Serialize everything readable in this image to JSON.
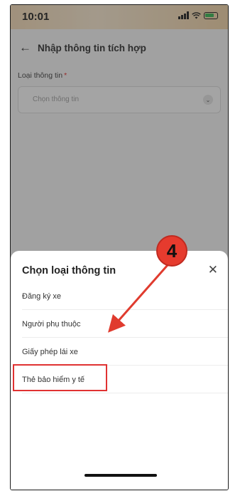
{
  "status_bar": {
    "time": "10:01"
  },
  "header": {
    "back_icon": "←",
    "title": "Nhập thông tin tích hợp"
  },
  "form": {
    "field_label": "Loại thông tin",
    "required_mark": "*",
    "select_placeholder": "Chọn thông tin",
    "chevron": "⌄"
  },
  "sheet": {
    "title": "Chọn loại thông tin",
    "close_icon": "✕",
    "options": [
      {
        "label": "Đăng ký xe"
      },
      {
        "label": "Người phụ thuộc"
      },
      {
        "label": "Giấy phép lái xe"
      },
      {
        "label": "Thẻ bảo hiểm y tế"
      }
    ]
  },
  "annotation": {
    "step_number": "4",
    "highlighted_option": "Thẻ bảo hiểm y tế",
    "highlight_color": "#e03232"
  }
}
